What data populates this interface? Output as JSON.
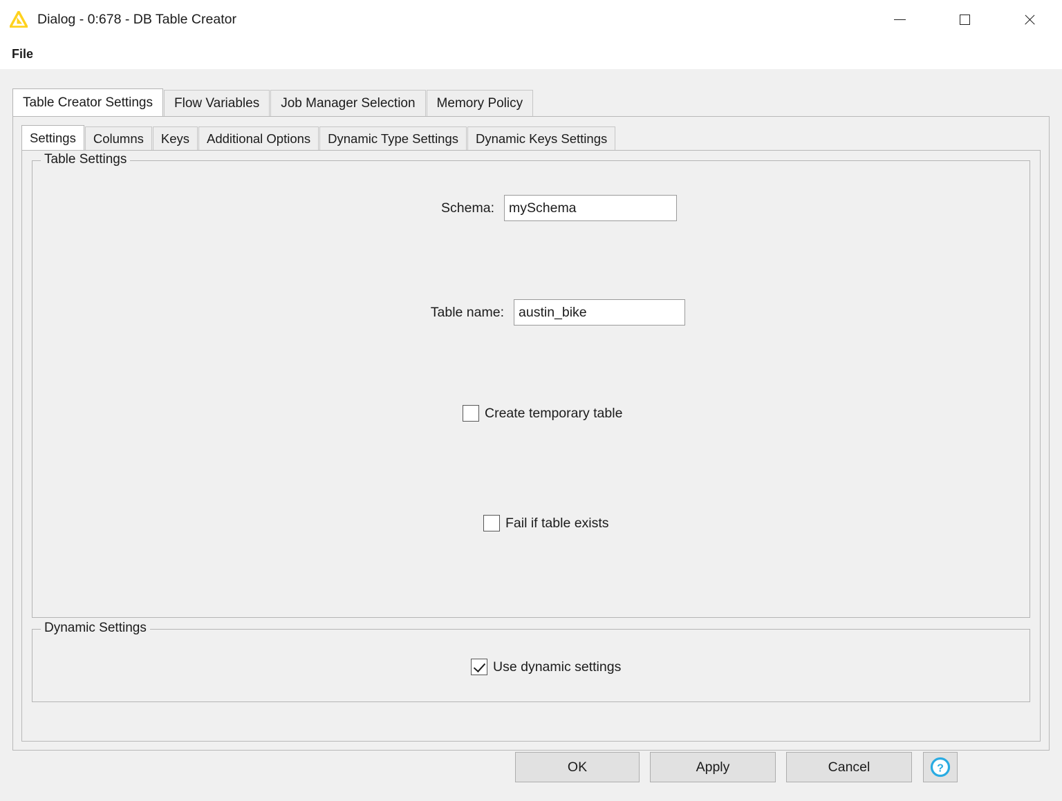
{
  "window": {
    "title": "Dialog - 0:678 - DB Table Creator",
    "app_icon": "knime-triangle-icon",
    "controls": {
      "minimize": "minimize-icon",
      "maximize": "maximize-icon",
      "close": "close-icon"
    }
  },
  "menubar": {
    "items": [
      {
        "label": "File"
      }
    ]
  },
  "outer_tabs": {
    "active_index": 0,
    "items": [
      {
        "label": "Table Creator Settings"
      },
      {
        "label": "Flow Variables"
      },
      {
        "label": "Job Manager Selection"
      },
      {
        "label": "Memory Policy"
      }
    ]
  },
  "inner_tabs": {
    "active_index": 0,
    "items": [
      {
        "label": "Settings"
      },
      {
        "label": "Columns"
      },
      {
        "label": "Keys"
      },
      {
        "label": "Additional Options"
      },
      {
        "label": "Dynamic Type Settings"
      },
      {
        "label": "Dynamic Keys Settings"
      }
    ]
  },
  "table_settings": {
    "group_title": "Table Settings",
    "schema": {
      "label": "Schema:",
      "value": "mySchema",
      "placeholder": ""
    },
    "table_name": {
      "label": "Table name:",
      "value": "austin_bike",
      "placeholder": ""
    },
    "create_temporary_table": {
      "label": "Create temporary table",
      "checked": false
    },
    "fail_if_table_exists": {
      "label": "Fail if table exists",
      "checked": false
    }
  },
  "dynamic_settings": {
    "group_title": "Dynamic Settings",
    "use_dynamic_settings": {
      "label": "Use dynamic settings",
      "checked": true
    }
  },
  "buttons": {
    "ok": "OK",
    "apply": "Apply",
    "cancel": "Cancel",
    "help_icon": "help-circle-icon"
  },
  "colors": {
    "accent_knime_yellow": "#FFD800",
    "help_blue": "#29ABE2",
    "window_bg": "#F0F0F0",
    "panel_white": "#FFFFFF",
    "text": "#1B1B1B"
  }
}
